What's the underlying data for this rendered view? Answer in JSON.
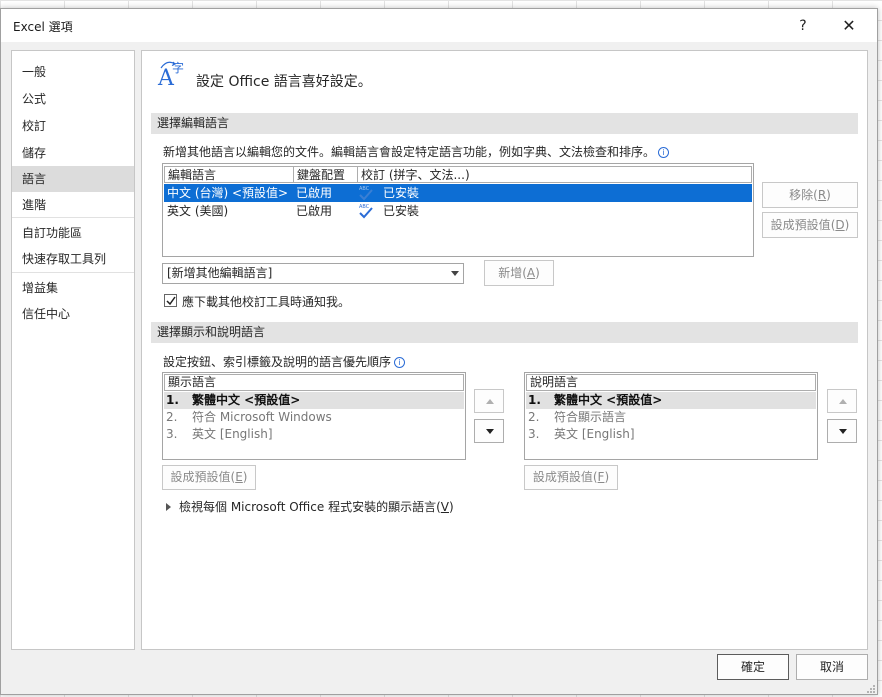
{
  "window": {
    "title": "Excel 選項",
    "help": "?",
    "close": "✕"
  },
  "nav": {
    "items": [
      "一般",
      "公式",
      "校訂",
      "儲存",
      "語言",
      "進階",
      "自訂功能區",
      "快速存取工具列",
      "增益集",
      "信任中心"
    ],
    "selected": "語言"
  },
  "header": {
    "title": "設定 Office 語言喜好設定。",
    "icon": "language-icon"
  },
  "editing": {
    "section_title": "選擇編輯語言",
    "description": "新增其他語言以編輯您的文件。編輯語言會設定特定語言功能，例如字典、文法檢查和排序。",
    "columns": [
      "編輯語言",
      "鍵盤配置",
      "校訂 (拼字、文法...)"
    ],
    "rows": [
      {
        "language": "中文 (台灣) <預設值>",
        "keyboard": "已啟用",
        "proofing": "已安裝",
        "selected": true
      },
      {
        "language": "英文 (美國)",
        "keyboard": "已啟用",
        "proofing": "已安裝",
        "selected": false
      }
    ],
    "remove_button": {
      "label": "移除",
      "hotkey": "R"
    },
    "set_default_button": {
      "label": "設成預設值",
      "hotkey": "D"
    },
    "add_combo_value": "[新增其他編輯語言]",
    "add_button": {
      "label": "新增",
      "hotkey": "A"
    },
    "notify_checkbox_label": "應下載其他校訂工具時通知我。",
    "notify_checked": true
  },
  "display": {
    "section_title": "選擇顯示和說明語言",
    "description": "設定按鈕、索引標籤及說明的語言優先順序",
    "display_list": {
      "header": "顯示語言",
      "items": [
        {
          "num": "1.",
          "text": "繁體中文 <預設值>",
          "selected": true
        },
        {
          "num": "2.",
          "text": "符合 Microsoft Windows",
          "selected": false
        },
        {
          "num": "3.",
          "text": "英文 [English]",
          "selected": false
        }
      ],
      "set_default": {
        "label": "設成預設值",
        "hotkey": "E"
      }
    },
    "help_list": {
      "header": "說明語言",
      "items": [
        {
          "num": "1.",
          "text": "繁體中文 <預設值>",
          "selected": true
        },
        {
          "num": "2.",
          "text": "符合顯示語言",
          "selected": false
        },
        {
          "num": "3.",
          "text": "英文 [English]",
          "selected": false
        }
      ],
      "set_default": {
        "label": "設成預設值",
        "hotkey": "F"
      }
    },
    "expander": {
      "label": "檢視每個 Microsoft Office 程式安裝的顯示語言",
      "hotkey": "V"
    }
  },
  "footer": {
    "ok": "確定",
    "cancel": "取消"
  },
  "colors": {
    "selection": "#0d6ed4",
    "accent_icon": "#2b6cd6"
  }
}
